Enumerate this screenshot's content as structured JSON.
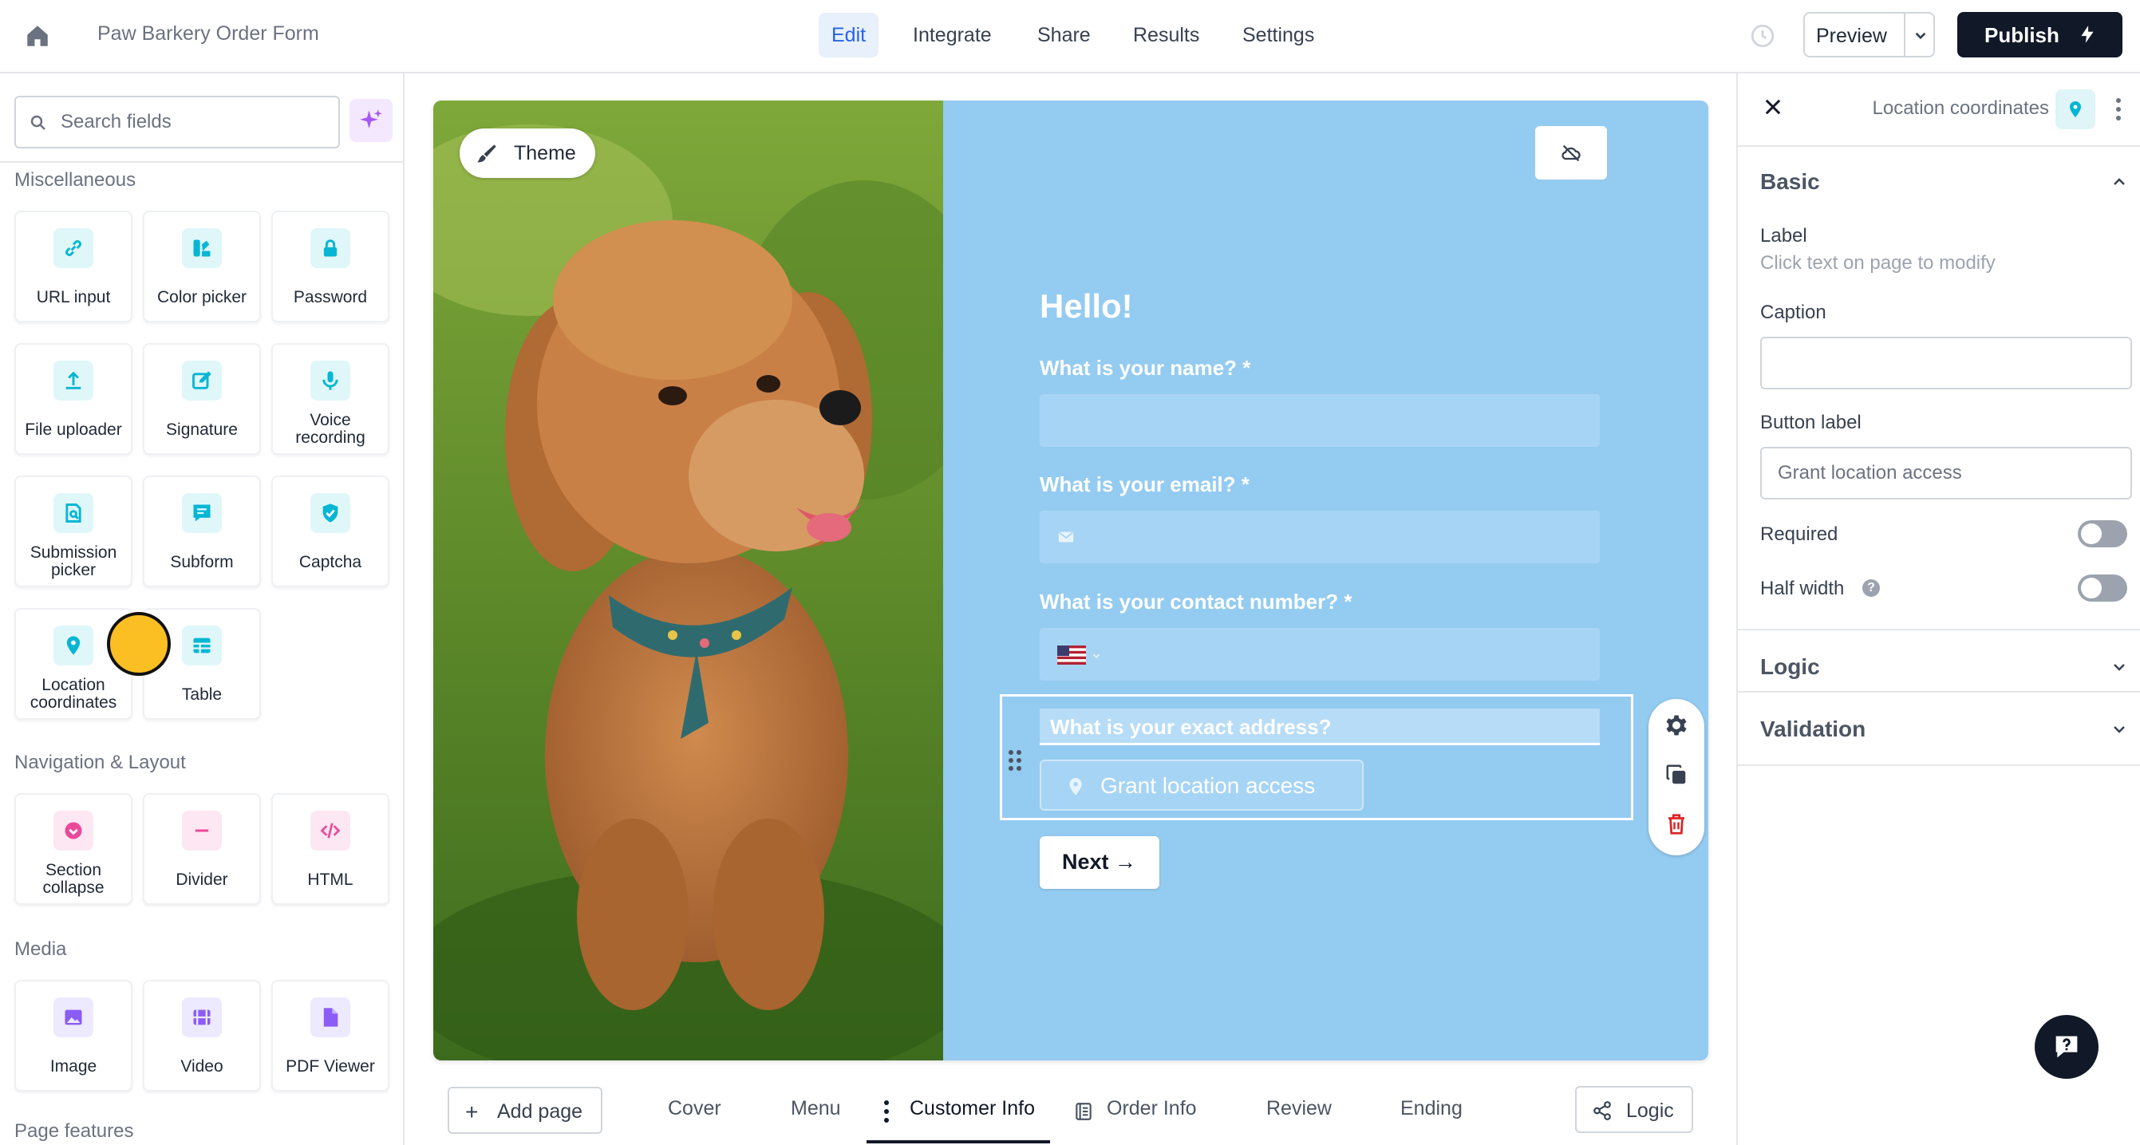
{
  "topbar": {
    "app_title": "Paw Barkery Order Form",
    "nav": [
      {
        "label": "Edit",
        "active": true
      },
      {
        "label": "Integrate",
        "active": false
      },
      {
        "label": "Share",
        "active": false
      },
      {
        "label": "Results",
        "active": false
      },
      {
        "label": "Settings",
        "active": false
      }
    ],
    "preview_label": "Preview",
    "publish_label": "Publish"
  },
  "sidebar": {
    "search_placeholder": "Search fields",
    "sections": [
      {
        "title": "Miscellaneous",
        "items": [
          {
            "label": "URL input",
            "icon": "link-icon"
          },
          {
            "label": "Color picker",
            "icon": "color-picker-icon"
          },
          {
            "label": "Password",
            "icon": "lock-icon"
          },
          {
            "label": "File uploader",
            "icon": "upload-icon"
          },
          {
            "label": "Signature",
            "icon": "signature-icon"
          },
          {
            "label": "Voice recording",
            "icon": "microphone-icon"
          },
          {
            "label": "Submission picker",
            "icon": "submission-picker-icon"
          },
          {
            "label": "Subform",
            "icon": "subform-icon"
          },
          {
            "label": "Captcha",
            "icon": "shield-check-icon"
          },
          {
            "label": "Location coordinates",
            "icon": "map-pin-icon"
          },
          {
            "label": "Table",
            "icon": "table-icon"
          }
        ]
      },
      {
        "title": "Navigation & Layout",
        "items": [
          {
            "label": "Section collapse",
            "icon": "section-collapse-icon"
          },
          {
            "label": "Divider",
            "icon": "divider-icon"
          },
          {
            "label": "HTML",
            "icon": "code-icon"
          }
        ]
      },
      {
        "title": "Media",
        "items": [
          {
            "label": "Image",
            "icon": "image-icon"
          },
          {
            "label": "Video",
            "icon": "video-icon"
          },
          {
            "label": "PDF Viewer",
            "icon": "pdf-icon"
          }
        ]
      },
      {
        "title": "Page features",
        "items": []
      }
    ]
  },
  "canvas": {
    "theme_label": "Theme",
    "heading": "Hello!",
    "questions": [
      {
        "label": "What is your name? *"
      },
      {
        "label": "What is your email? *"
      },
      {
        "label": "What is your contact number? *"
      }
    ],
    "selected_field": {
      "label": "What is your exact address?",
      "button_label": "Grant location access"
    },
    "next_label": "Next →",
    "form_bg": "#94cbf1"
  },
  "pages": {
    "add_page_label": "Add page",
    "tabs": [
      {
        "label": "Cover",
        "active": false
      },
      {
        "label": "Menu",
        "active": false
      },
      {
        "label": "Customer Info",
        "active": true
      },
      {
        "label": "Order Info",
        "active": false
      },
      {
        "label": "Review",
        "active": false
      },
      {
        "label": "Ending",
        "active": false
      }
    ],
    "logic_label": "Logic"
  },
  "panel": {
    "title": "Location coordinates",
    "basic_heading": "Basic",
    "label_title": "Label",
    "label_hint": "Click text on page to modify",
    "caption_title": "Caption",
    "caption_value": "",
    "button_label_title": "Button label",
    "button_label_placeholder": "Grant location access",
    "required_label": "Required",
    "required_on": false,
    "half_width_label": "Half width",
    "half_width_on": false,
    "logic_heading": "Logic",
    "validation_heading": "Validation"
  },
  "colors": {
    "accent": "#2563eb",
    "publish_bg": "#111827",
    "teal_icon": "#06b6d4",
    "purple_icon": "#8b5cf6",
    "pink_icon": "#ec4899"
  }
}
